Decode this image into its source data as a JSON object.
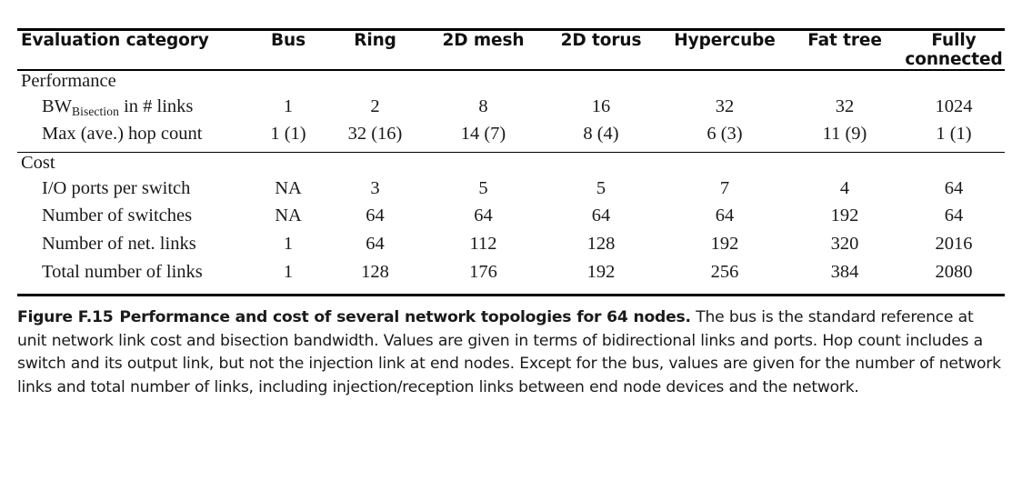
{
  "table": {
    "columns": [
      "Evaluation category",
      "Bus",
      "Ring",
      "2D mesh",
      "2D torus",
      "Hypercube",
      "Fat tree",
      "Fully connected"
    ],
    "sections": [
      {
        "title": "Performance",
        "rows": [
          {
            "label_prefix": "BW",
            "label_subscript": "Bisection",
            "label_suffix": " in # links",
            "values": [
              "1",
              "2",
              "8",
              "16",
              "32",
              "32",
              "1024"
            ]
          },
          {
            "label": "Max (ave.) hop count",
            "values": [
              "1 (1)",
              "32 (16)",
              "14 (7)",
              "8 (4)",
              "6 (3)",
              "11 (9)",
              "1 (1)"
            ]
          }
        ]
      },
      {
        "title": "Cost",
        "rows": [
          {
            "label": "I/O ports per switch",
            "values": [
              "NA",
              "3",
              "5",
              "5",
              "7",
              "4",
              "64"
            ]
          },
          {
            "label": "Number of switches",
            "values": [
              "NA",
              "64",
              "64",
              "64",
              "64",
              "192",
              "64"
            ]
          },
          {
            "label": "Number of net. links",
            "values": [
              "1",
              "64",
              "112",
              "128",
              "192",
              "320",
              "2016"
            ]
          },
          {
            "label": "Total number of links",
            "values": [
              "1",
              "128",
              "176",
              "192",
              "256",
              "384",
              "2080"
            ]
          }
        ]
      }
    ]
  },
  "caption": {
    "figure_number": "Figure F.15",
    "title": "Performance and cost of several network topologies for 64 nodes.",
    "body": "The bus is the standard reference at unit network link cost and bisection bandwidth. Values are given in terms of bidirectional links and ports. Hop count includes a switch and its output link, but not the injection link at end nodes. Except for the bus, values are given for the number of network links and total number of links, including injection/reception links between end node devices and the network."
  }
}
